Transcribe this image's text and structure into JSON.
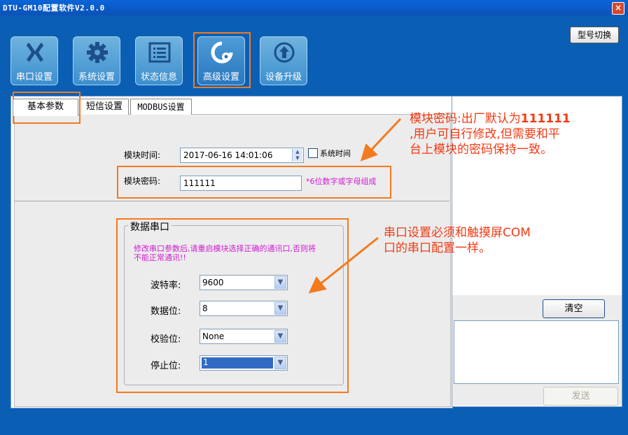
{
  "window": {
    "title": "DTU-GM10配置软件V2.0.0",
    "close": "×"
  },
  "toolbar": {
    "model_switch": "型号切换",
    "nav": [
      {
        "label": "串口设置",
        "icon": "cross-arrows-icon"
      },
      {
        "label": "系统设置",
        "icon": "gear-icon"
      },
      {
        "label": "状态信息",
        "icon": "list-icon"
      },
      {
        "label": "高级设置",
        "icon": "advanced-gear-icon",
        "active": true
      },
      {
        "label": "设备升级",
        "icon": "upload-circle-icon"
      }
    ]
  },
  "tabs": [
    "基本参数",
    "短信设置",
    "MODBUS设置"
  ],
  "basic": {
    "time_label": "模块时间:",
    "time_value": "2017-06-16 14:01:06",
    "sys_time_label": "系统时间",
    "password_label": "模块密码:",
    "password_value": "111111",
    "password_hint": "*6位数字或字母组成"
  },
  "serial_group": {
    "title": "数据串口",
    "warning_line1": "修改串口参数后,请重启模块选择正确的通讯口,否则将",
    "warning_line2": "不能正常通讯!!",
    "fields": [
      {
        "label": "波特率:",
        "value": "9600"
      },
      {
        "label": "数据位:",
        "value": "8"
      },
      {
        "label": "校验位:",
        "value": "None"
      },
      {
        "label": "停止位:",
        "value": "1"
      }
    ]
  },
  "right": {
    "clear": "清空",
    "send": "发送"
  },
  "annotations": {
    "note1_line1_a": "模块密码:出厂默认为",
    "note1_line1_b": "111111",
    "note1_line2": ",用户可自行修改,但需要和平",
    "note1_line3": "台上模块的密码保持一致。",
    "note2_line1": "串口设置必须和触摸屏COM",
    "note2_line2": "口的串口配置一样。"
  },
  "colors": {
    "highlight": "#f47a1f",
    "note": "#f23a14",
    "hint": "#d11ad1"
  }
}
